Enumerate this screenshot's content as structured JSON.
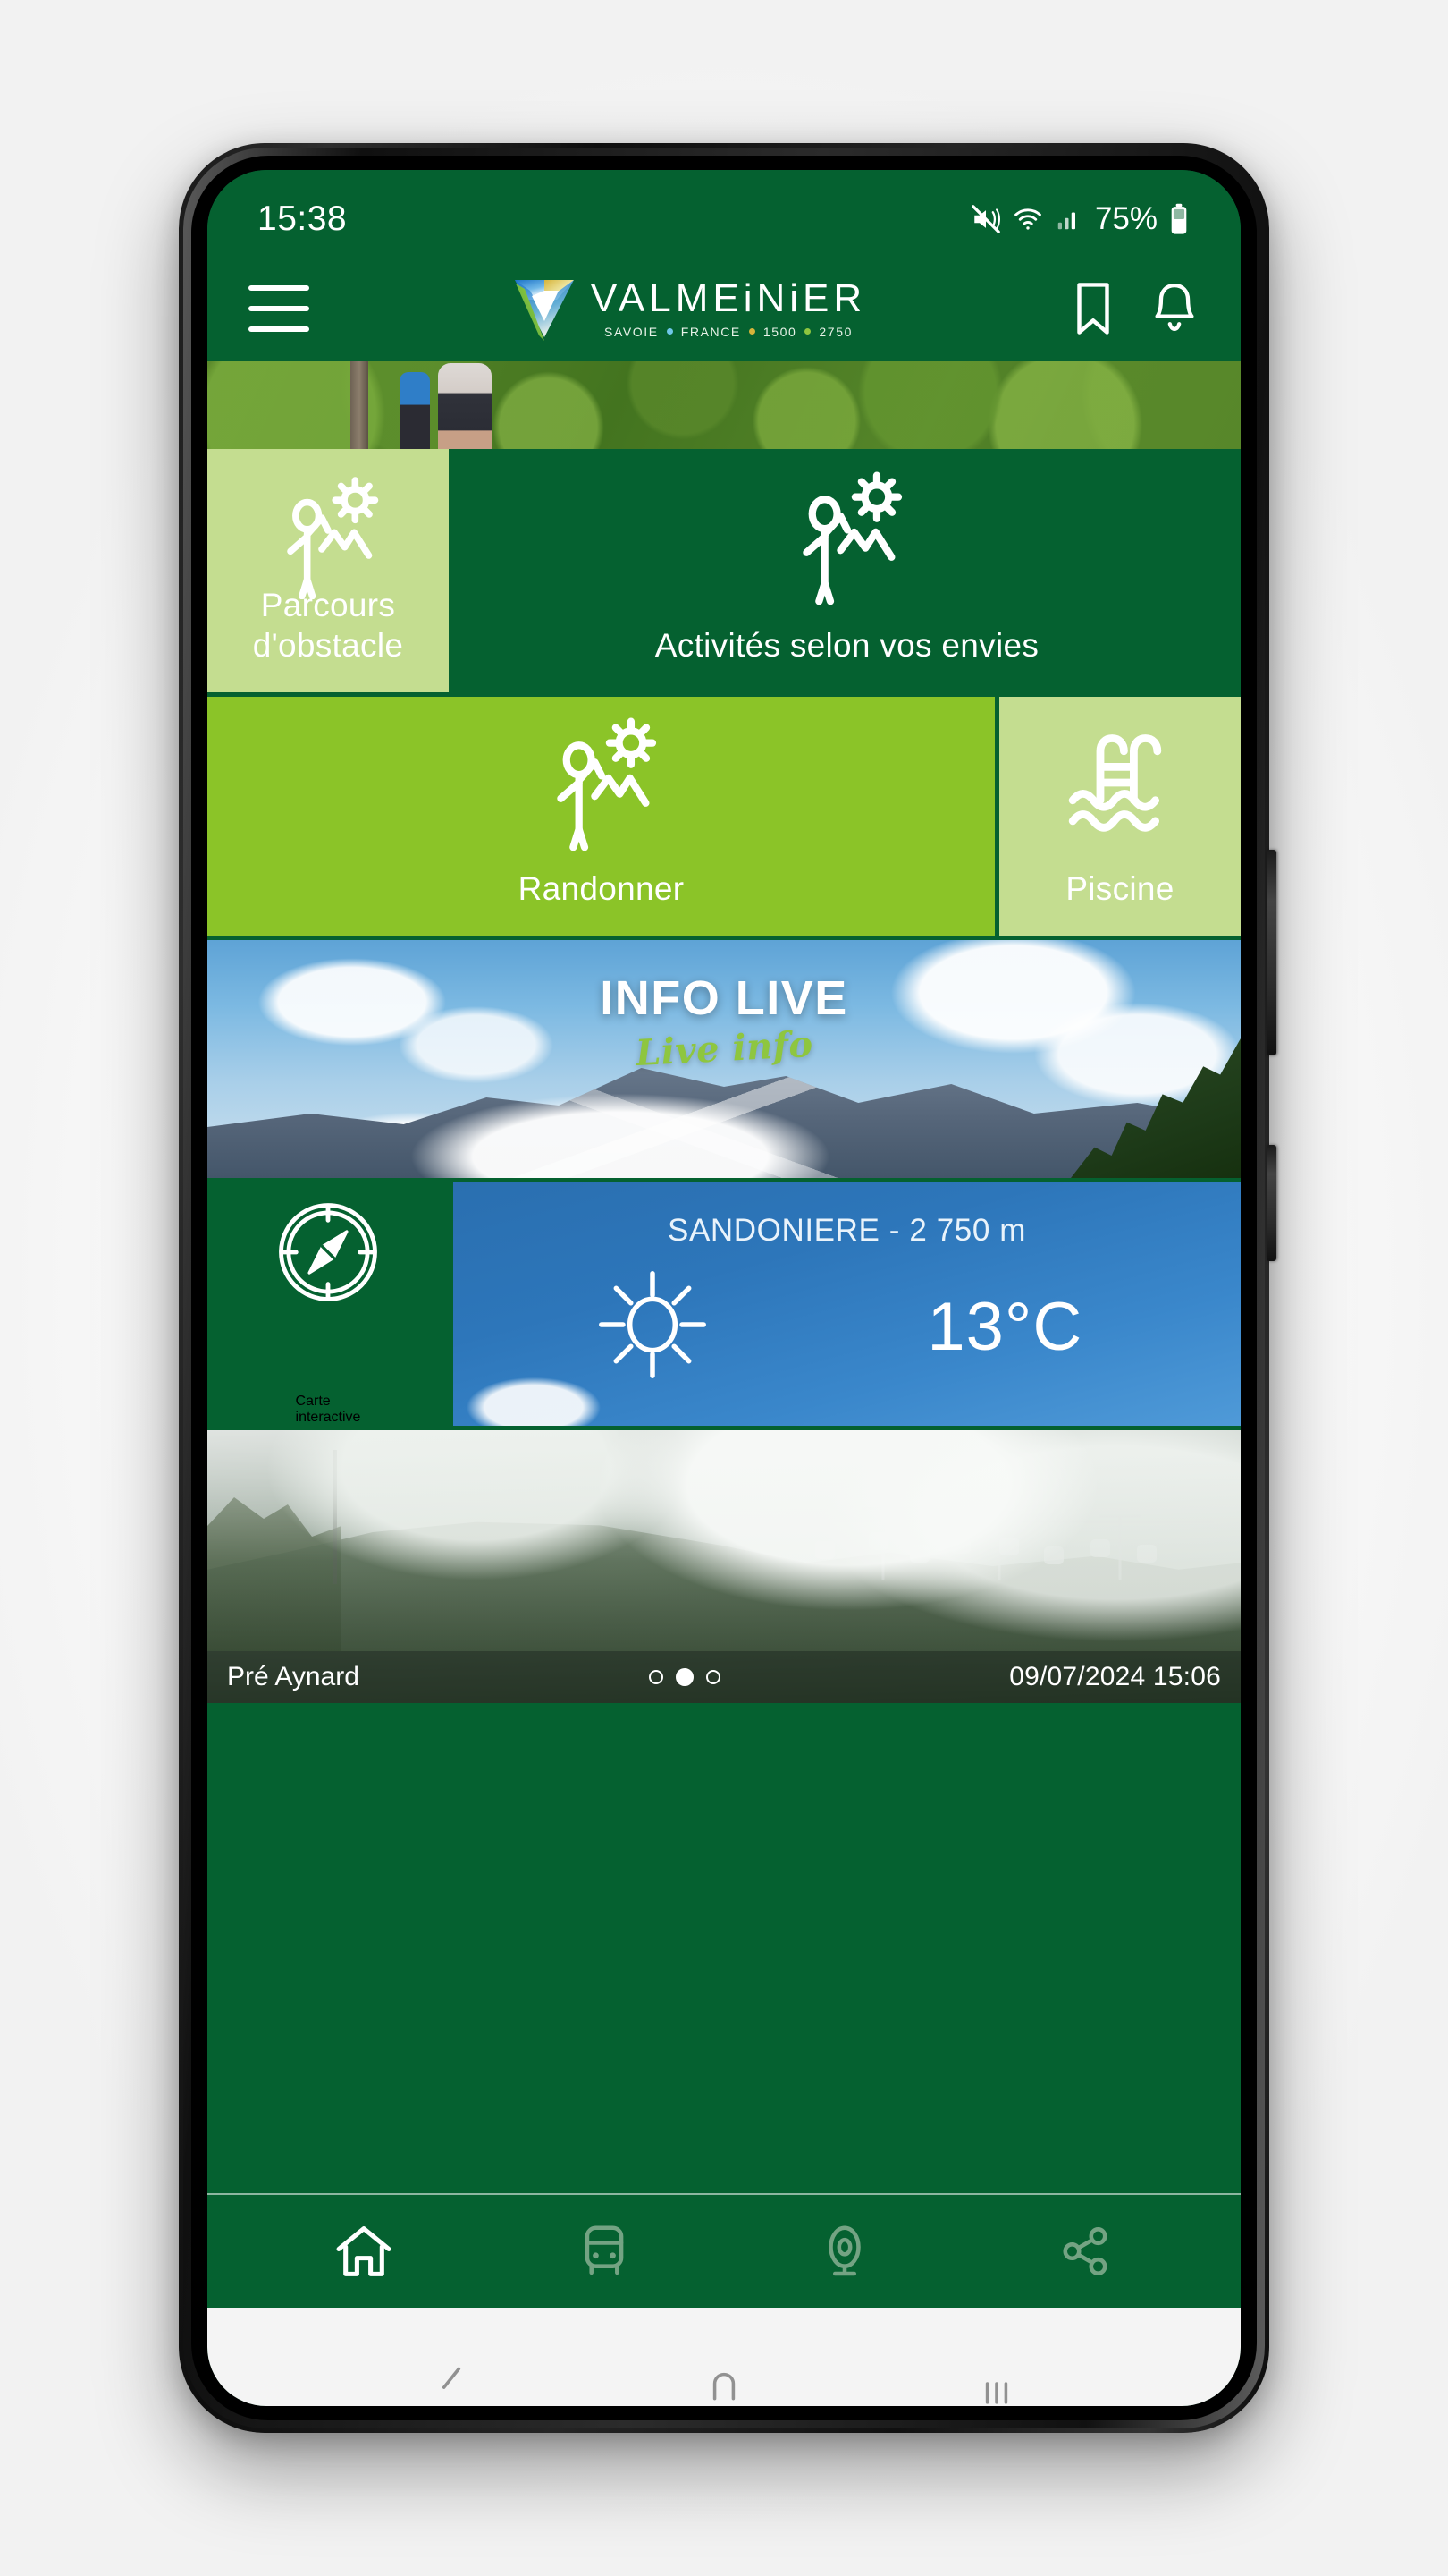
{
  "status_bar": {
    "time": "15:38",
    "battery_percent": "75%",
    "icons": [
      "mute-icon",
      "wifi-icon",
      "signal-icon",
      "battery-icon"
    ]
  },
  "app_bar": {
    "menu_icon": "hamburger-menu-icon",
    "brand": {
      "name": "VALMEiNiER",
      "tagline_parts": [
        "SAVOIE",
        "FRANCE",
        "1500",
        "2750"
      ],
      "tagline_separator": "•"
    },
    "actions": [
      {
        "icon": "bookmark-icon",
        "name": "bookmark-button"
      },
      {
        "icon": "bell-icon",
        "name": "notifications-button"
      }
    ]
  },
  "tiles": [
    {
      "label": "Parcours\nd'obstacle",
      "line1": "Parcours",
      "line2": "d'obstacle",
      "icon": "hiker-sun-icon",
      "color": "#c4dd90"
    },
    {
      "label": "Activités selon vos envies",
      "line1": "Activités selon vos envies",
      "line2": "",
      "icon": "hiker-sun-icon",
      "color": "#056130"
    },
    {
      "label": "Randonner",
      "line1": "Randonner",
      "line2": "",
      "icon": "hiker-sun-icon",
      "color": "#8bc428"
    },
    {
      "label": "Piscine",
      "line1": "Piscine",
      "line2": "",
      "icon": "pool-ladder-icon",
      "color": "#c4dd90"
    }
  ],
  "info_live": {
    "title": "INFO LIVE",
    "subtitle": "Live info"
  },
  "map_card": {
    "line1": "Carte",
    "line2": "interactive",
    "icon": "compass-icon"
  },
  "weather": {
    "station": "SANDONIERE - 2 750 m",
    "temperature": "13°C",
    "condition_icon": "sun-icon"
  },
  "webcam": {
    "location": "Pré Aynard",
    "timestamp": "09/07/2024 15:06",
    "carousel_dots": 3,
    "carousel_active_index": 1
  },
  "bottom_nav": [
    {
      "name": "nav-home",
      "icon": "home-icon",
      "active": true
    },
    {
      "name": "nav-transport",
      "icon": "bus-icon",
      "active": false
    },
    {
      "name": "nav-webcam",
      "icon": "webcam-icon",
      "active": false
    },
    {
      "name": "nav-share",
      "icon": "share-icon",
      "active": false
    }
  ],
  "system_nav": [
    {
      "name": "android-back-button",
      "icon": "back-icon"
    },
    {
      "name": "android-home-button",
      "icon": "home-pill-icon"
    },
    {
      "name": "android-recents-button",
      "icon": "recents-icon"
    }
  ],
  "colors": {
    "brand_dark_green": "#056130",
    "brand_bright_green": "#8bc428",
    "brand_light_green": "#c4dd90",
    "weather_blue": "#2d76ba",
    "accent_lime": "#8ec63f"
  }
}
